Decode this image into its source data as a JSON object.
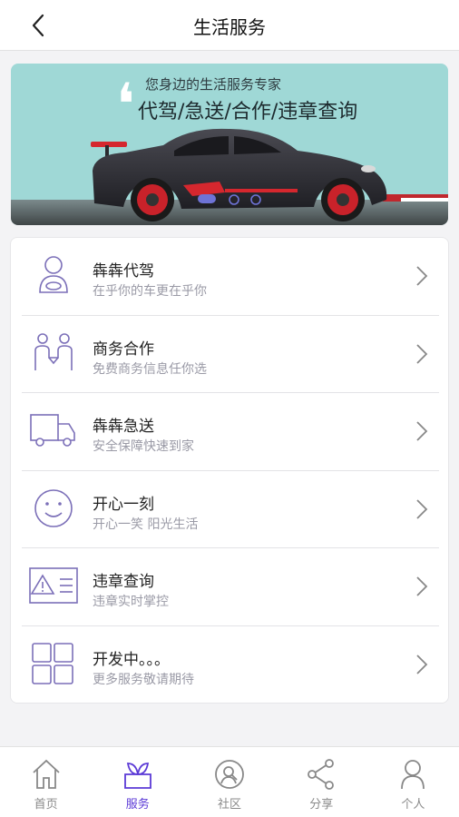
{
  "header": {
    "title": "生活服务"
  },
  "banner": {
    "subtitle": "您身边的生活服务专家",
    "headline": "代驾/急送/合作/违章查询"
  },
  "services": [
    {
      "name": "犇犇代驾",
      "desc": "在乎你的车更在乎你",
      "icon": "driver-icon"
    },
    {
      "name": "商务合作",
      "desc": "免费商务信息任你选",
      "icon": "business-partners-icon"
    },
    {
      "name": "犇犇急送",
      "desc": "安全保障快速到家",
      "icon": "delivery-truck-icon"
    },
    {
      "name": "开心一刻",
      "desc": "开心一笑 阳光生活",
      "icon": "smile-icon"
    },
    {
      "name": "违章查询",
      "desc": "违章实时掌控",
      "icon": "violation-warning-icon"
    },
    {
      "name": "开发中。。。",
      "desc": "更多服务敬请期待",
      "icon": "grid-icon"
    }
  ],
  "tabs": [
    {
      "label": "首页",
      "icon": "home-icon"
    },
    {
      "label": "服务",
      "icon": "plant-icon",
      "active": true
    },
    {
      "label": "社区",
      "icon": "community-icon"
    },
    {
      "label": "分享",
      "icon": "share-icon"
    },
    {
      "label": "个人",
      "icon": "person-icon"
    }
  ],
  "colors": {
    "accent": "#5b3ad6",
    "icon_stroke": "#7b6fb8",
    "banner_bg": "#9fd8d6"
  }
}
